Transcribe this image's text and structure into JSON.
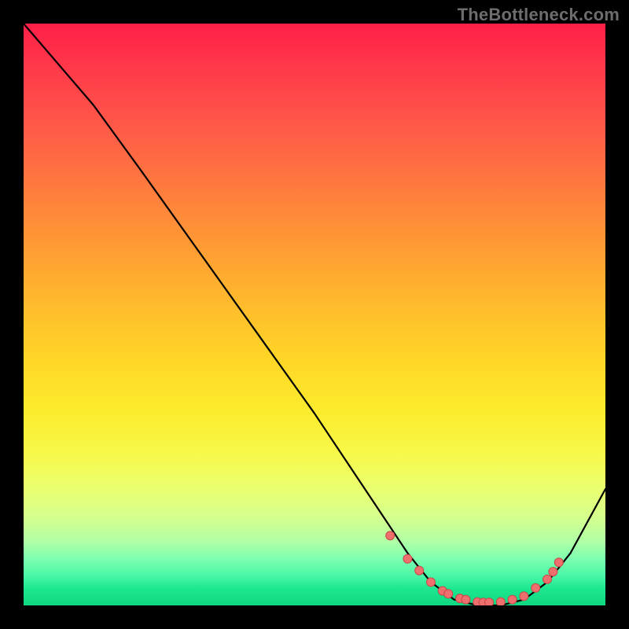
{
  "watermark": "TheBottleneck.com",
  "colors": {
    "background": "#000000",
    "curve": "#000000",
    "dot_fill": "#ef6e6e",
    "dot_stroke": "#c94848",
    "gradient_top": "#ff1f47",
    "gradient_bottom": "#0dd880"
  },
  "chart_data": {
    "type": "line",
    "title": "",
    "xlabel": "",
    "ylabel": "",
    "xlim": [
      0,
      100
    ],
    "ylim": [
      0,
      100
    ],
    "grid": false,
    "curve_note": "y-axis is inverted for SVG rendering; values below are bottleneck % (0 = best/green bottom, 100 = worst/red top)",
    "series": [
      {
        "name": "bottleneck-curve",
        "x": [
          0,
          6,
          12,
          20,
          30,
          40,
          50,
          58,
          62,
          66,
          70,
          74,
          78,
          82,
          86,
          90,
          94,
          100
        ],
        "y": [
          100,
          93,
          86,
          75,
          61,
          47,
          33,
          21,
          15,
          9,
          4,
          1,
          0,
          0,
          1,
          4,
          9,
          20
        ]
      }
    ],
    "optimal_dots": {
      "name": "optimal-range",
      "x": [
        63,
        66,
        68,
        70,
        72,
        73,
        75,
        76,
        78,
        79,
        80,
        82,
        84,
        86,
        88,
        90,
        91,
        92
      ],
      "y": [
        12,
        8,
        6,
        4,
        2.5,
        2,
        1.2,
        1,
        0.6,
        0.5,
        0.5,
        0.6,
        1,
        1.6,
        3,
        4.5,
        5.8,
        7.4
      ]
    }
  }
}
